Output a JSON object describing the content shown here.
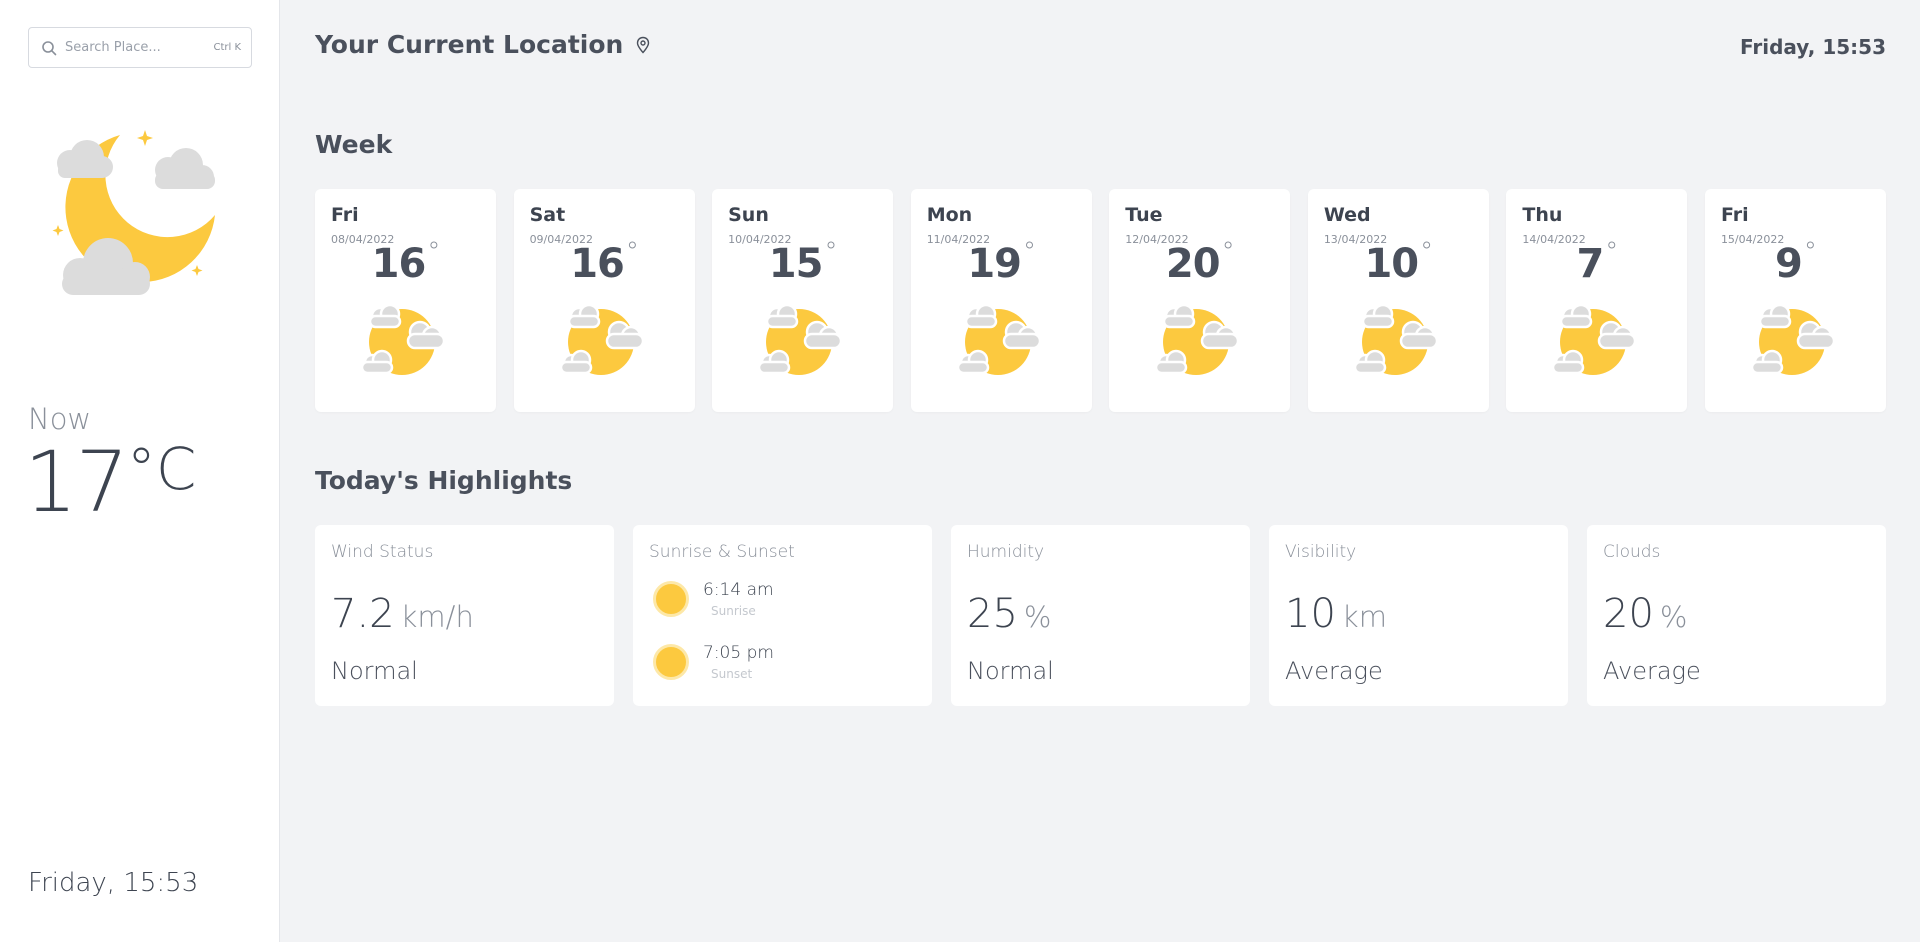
{
  "search": {
    "placeholder": "Search Place...",
    "shortcut": "Ctrl K"
  },
  "sidebar": {
    "now_label": "Now",
    "temp": "17",
    "temp_unit": "°C",
    "datetime": "Friday, 15:53",
    "weather_icon": "moon-clouds-stars-icon"
  },
  "header": {
    "title": "Your Current Location",
    "datetime": "Friday, 15:53",
    "pin_icon": "map-pin-icon"
  },
  "week": {
    "title": "Week",
    "days": [
      {
        "name": "Fri",
        "date": "08/04/2022",
        "temp": "16",
        "deg": "°"
      },
      {
        "name": "Sat",
        "date": "09/04/2022",
        "temp": "16",
        "deg": "°"
      },
      {
        "name": "Sun",
        "date": "10/04/2022",
        "temp": "15",
        "deg": "°"
      },
      {
        "name": "Mon",
        "date": "11/04/2022",
        "temp": "19",
        "deg": "°"
      },
      {
        "name": "Tue",
        "date": "12/04/2022",
        "temp": "20",
        "deg": "°"
      },
      {
        "name": "Wed",
        "date": "13/04/2022",
        "temp": "10",
        "deg": "°"
      },
      {
        "name": "Thu",
        "date": "14/04/2022",
        "temp": "7",
        "deg": "°"
      },
      {
        "name": "Fri",
        "date": "15/04/2022",
        "temp": "9",
        "deg": "°"
      }
    ]
  },
  "highlights": {
    "title": "Today's Highlights",
    "wind": {
      "title": "Wind Status",
      "value": "7.2",
      "unit": "km/h",
      "status": "Normal"
    },
    "sun": {
      "title": "Sunrise & Sunset",
      "sunrise_time": "6:14 am",
      "sunrise_label": "Sunrise",
      "sunset_time": "7:05 pm",
      "sunset_label": "Sunset"
    },
    "humidity": {
      "title": "Humidity",
      "value": "25",
      "unit": "%",
      "status": "Normal"
    },
    "visibility": {
      "title": "Visibility",
      "value": "10",
      "unit": "km",
      "status": "Average"
    },
    "clouds": {
      "title": "Clouds",
      "value": "20",
      "unit": "%",
      "status": "Average"
    }
  },
  "colors": {
    "sun": "#fcc93f",
    "cloud": "#dcdcdc",
    "background": "#f2f3f5"
  }
}
